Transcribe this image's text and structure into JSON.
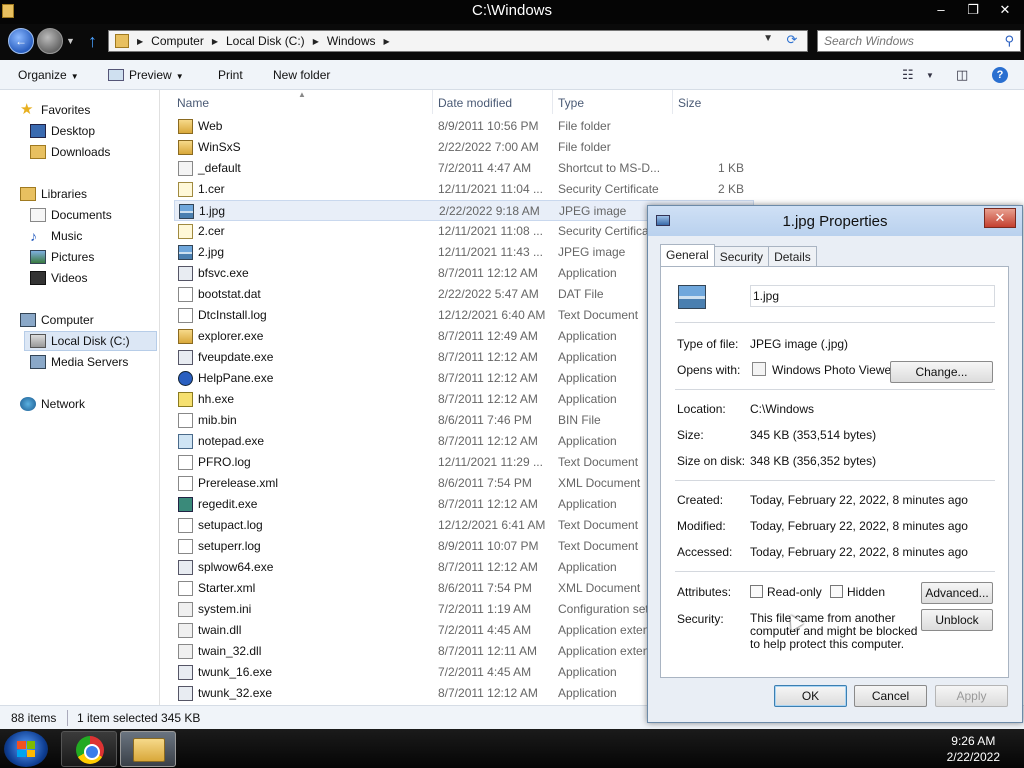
{
  "window": {
    "title": "C:\\Windows",
    "minimize": "–",
    "maximize": "❐",
    "close": "✕"
  },
  "address": {
    "crumbs": [
      "Computer",
      "Local Disk (C:)",
      "Windows"
    ],
    "search_placeholder": "Search Windows"
  },
  "toolbar": {
    "organize": "Organize",
    "preview": "Preview",
    "print": "Print",
    "new_folder": "New folder"
  },
  "nav": {
    "favorites": "Favorites",
    "desktop": "Desktop",
    "downloads": "Downloads",
    "libraries": "Libraries",
    "documents": "Documents",
    "music": "Music",
    "pictures": "Pictures",
    "videos": "Videos",
    "computer": "Computer",
    "local_disk": "Local Disk (C:)",
    "media_servers": "Media Servers",
    "network": "Network"
  },
  "columns": {
    "name": "Name",
    "date": "Date modified",
    "type": "Type",
    "size": "Size"
  },
  "files": [
    {
      "name": "Web",
      "date": "8/9/2011 10:56 PM",
      "type": "File folder",
      "size": "",
      "icon": "folder"
    },
    {
      "name": "WinSxS",
      "date": "2/22/2022 7:00 AM",
      "type": "File folder",
      "size": "",
      "icon": "folder"
    },
    {
      "name": "_default",
      "date": "7/2/2011 4:47 AM",
      "type": "Shortcut to MS-D...",
      "size": "1 KB",
      "icon": "shortcut"
    },
    {
      "name": "1.cer",
      "date": "12/11/2021 11:04 ...",
      "type": "Security Certificate",
      "size": "2 KB",
      "icon": "cert"
    },
    {
      "name": "1.jpg",
      "date": "2/22/2022 9:18 AM",
      "type": "JPEG image",
      "size": "",
      "icon": "image"
    },
    {
      "name": "2.cer",
      "date": "12/11/2021 11:08 ...",
      "type": "Security Certificate",
      "size": "",
      "icon": "cert"
    },
    {
      "name": "2.jpg",
      "date": "12/11/2021 11:43 ...",
      "type": "JPEG image",
      "size": "",
      "icon": "image"
    },
    {
      "name": "bfsvc.exe",
      "date": "8/7/2011 12:12 AM",
      "type": "Application",
      "size": "",
      "icon": "exe"
    },
    {
      "name": "bootstat.dat",
      "date": "2/22/2022 5:47 AM",
      "type": "DAT File",
      "size": "",
      "icon": "file"
    },
    {
      "name": "DtcInstall.log",
      "date": "12/12/2021 6:40 AM",
      "type": "Text Document",
      "size": "",
      "icon": "text"
    },
    {
      "name": "explorer.exe",
      "date": "8/7/2011 12:49 AM",
      "type": "Application",
      "size": "",
      "icon": "explorer"
    },
    {
      "name": "fveupdate.exe",
      "date": "8/7/2011 12:12 AM",
      "type": "Application",
      "size": "",
      "icon": "exe"
    },
    {
      "name": "HelpPane.exe",
      "date": "8/7/2011 12:12 AM",
      "type": "Application",
      "size": "",
      "icon": "help"
    },
    {
      "name": "hh.exe",
      "date": "8/7/2011 12:12 AM",
      "type": "Application",
      "size": "",
      "icon": "hh"
    },
    {
      "name": "mib.bin",
      "date": "8/6/2011 7:46 PM",
      "type": "BIN File",
      "size": "",
      "icon": "file"
    },
    {
      "name": "notepad.exe",
      "date": "8/7/2011 12:12 AM",
      "type": "Application",
      "size": "",
      "icon": "notepad"
    },
    {
      "name": "PFRO.log",
      "date": "12/11/2021 11:29 ...",
      "type": "Text Document",
      "size": "",
      "icon": "text"
    },
    {
      "name": "Prerelease.xml",
      "date": "8/6/2011 7:54 PM",
      "type": "XML Document",
      "size": "",
      "icon": "xml"
    },
    {
      "name": "regedit.exe",
      "date": "8/7/2011 12:12 AM",
      "type": "Application",
      "size": "",
      "icon": "regedit"
    },
    {
      "name": "setupact.log",
      "date": "12/12/2021 6:41 AM",
      "type": "Text Document",
      "size": "",
      "icon": "text"
    },
    {
      "name": "setuperr.log",
      "date": "8/9/2011 10:07 PM",
      "type": "Text Document",
      "size": "",
      "icon": "text"
    },
    {
      "name": "splwow64.exe",
      "date": "8/7/2011 12:12 AM",
      "type": "Application",
      "size": "",
      "icon": "exe"
    },
    {
      "name": "Starter.xml",
      "date": "8/6/2011 7:54 PM",
      "type": "XML Document",
      "size": "",
      "icon": "xml"
    },
    {
      "name": "system.ini",
      "date": "7/2/2011 1:19 AM",
      "type": "Configuration set...",
      "size": "",
      "icon": "ini"
    },
    {
      "name": "twain.dll",
      "date": "7/2/2011 4:45 AM",
      "type": "Application exten...",
      "size": "",
      "icon": "dll"
    },
    {
      "name": "twain_32.dll",
      "date": "8/7/2011 12:11 AM",
      "type": "Application exten...",
      "size": "",
      "icon": "dll"
    },
    {
      "name": "twunk_16.exe",
      "date": "7/2/2011 4:45 AM",
      "type": "Application",
      "size": "",
      "icon": "exe"
    },
    {
      "name": "twunk_32.exe",
      "date": "8/7/2011 12:12 AM",
      "type": "Application",
      "size": "",
      "icon": "exe"
    }
  ],
  "status": {
    "count": "88 items",
    "selected": "1 item selected  345 KB"
  },
  "taskbar": {
    "time": "9:26 AM",
    "date": "2/22/2022"
  },
  "dialog": {
    "title": "1.jpg Properties",
    "close": "✕",
    "tabs": [
      "General",
      "Security",
      "Details"
    ],
    "filename": "1.jpg",
    "type_label": "Type of file:",
    "type_value": "JPEG image (.jpg)",
    "opens_label": "Opens with:",
    "opens_value": "Windows Photo Viewer",
    "change": "Change...",
    "location_label": "Location:",
    "location_value": "C:\\Windows",
    "size_label": "Size:",
    "size_value": "345 KB (353,514 bytes)",
    "disk_label": "Size on disk:",
    "disk_value": "348 KB (356,352 bytes)",
    "created_label": "Created:",
    "created_value": "Today, February 22, 2022, 8 minutes ago",
    "modified_label": "Modified:",
    "modified_value": "Today, February 22, 2022, 8 minutes ago",
    "accessed_label": "Accessed:",
    "accessed_value": "Today, February 22, 2022, 8 minutes ago",
    "attributes_label": "Attributes:",
    "readonly": "Read-only",
    "hidden": "Hidden",
    "advanced": "Advanced...",
    "security_label": "Security:",
    "security_text": "This file came from another computer and might be blocked to help protect this computer.",
    "unblock": "Unblock",
    "ok": "OK",
    "cancel": "Cancel",
    "apply": "Apply"
  }
}
